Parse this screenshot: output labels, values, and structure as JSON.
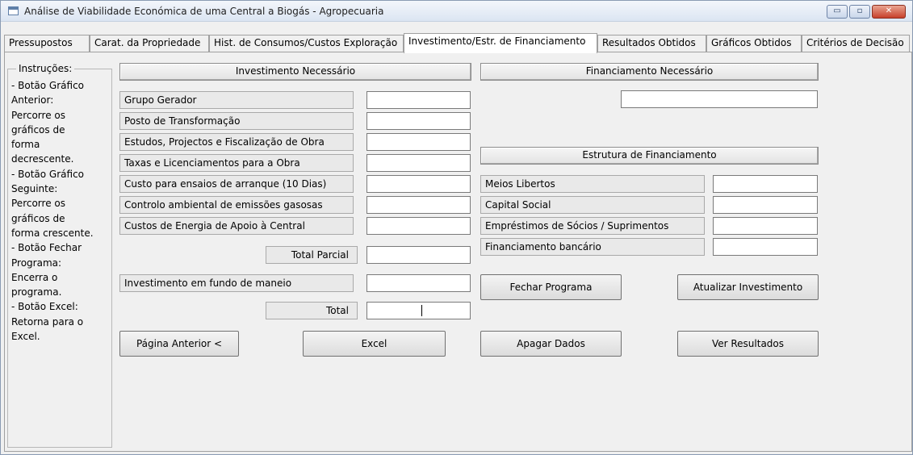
{
  "window": {
    "title": "Análise de Viabilidade Económica de uma Central a Biogás - Agropecuaria",
    "controls": {
      "minimize": "▭",
      "maximize": "▫",
      "close": "✕"
    }
  },
  "tabs": [
    {
      "label": "Pressupostos"
    },
    {
      "label": "Carat. da Propriedade"
    },
    {
      "label": "Hist. de Consumos/Custos Exploração"
    },
    {
      "label": "Investimento/Estr. de Financiamento"
    },
    {
      "label": "Resultados Obtidos"
    },
    {
      "label": "Gráficos Obtidos"
    },
    {
      "label": "Critérios de Decisão"
    }
  ],
  "instructions": {
    "title": "Instruções:",
    "text": "- Botão Gráfico\nAnterior:\nPercorre os\ngráficos de\nforma\ndecrescente.\n- Botão Gráfico\nSeguinte:\nPercorre os\ngráficos de\nforma crescente.\n- Botão Fechar\nPrograma:\nEncerra o\nprograma.\n- Botão Excel:\nRetorna para o\nExcel."
  },
  "investment": {
    "header": "Investimento Necessário",
    "items": [
      {
        "label": "Grupo Gerador",
        "value": ""
      },
      {
        "label": "Posto de Transformação",
        "value": ""
      },
      {
        "label": "Estudos, Projectos e Fiscalização de Obra",
        "value": ""
      },
      {
        "label": "Taxas e Licenciamentos para a Obra",
        "value": ""
      },
      {
        "label": "Custo para ensaios de arranque (10 Dias)",
        "value": ""
      },
      {
        "label": "Controlo ambiental de emissões gasosas",
        "value": ""
      },
      {
        "label": "Custos de Energia de Apoio à Central",
        "value": ""
      }
    ],
    "total_parcial_label": "Total Parcial",
    "total_parcial_value": "",
    "fundo_maneio_label": "Investimento em fundo de maneio",
    "fundo_maneio_value": "",
    "total_label": "Total",
    "total_value": ""
  },
  "financing": {
    "header": "Financiamento Necessário",
    "value": "",
    "structure_header": "Estrutura de Financiamento",
    "items": [
      {
        "label": "Meios Libertos",
        "value": ""
      },
      {
        "label": "Capital Social",
        "value": ""
      },
      {
        "label": "Empréstimos de Sócios / Suprimentos",
        "value": ""
      },
      {
        "label": "Financiamento bancário",
        "value": ""
      }
    ]
  },
  "buttons": {
    "fechar": "Fechar Programa",
    "atualizar": "Atualizar Investimento",
    "anterior": "Página Anterior <",
    "excel": "Excel",
    "apagar": "Apagar Dados",
    "ver": "Ver Resultados"
  }
}
